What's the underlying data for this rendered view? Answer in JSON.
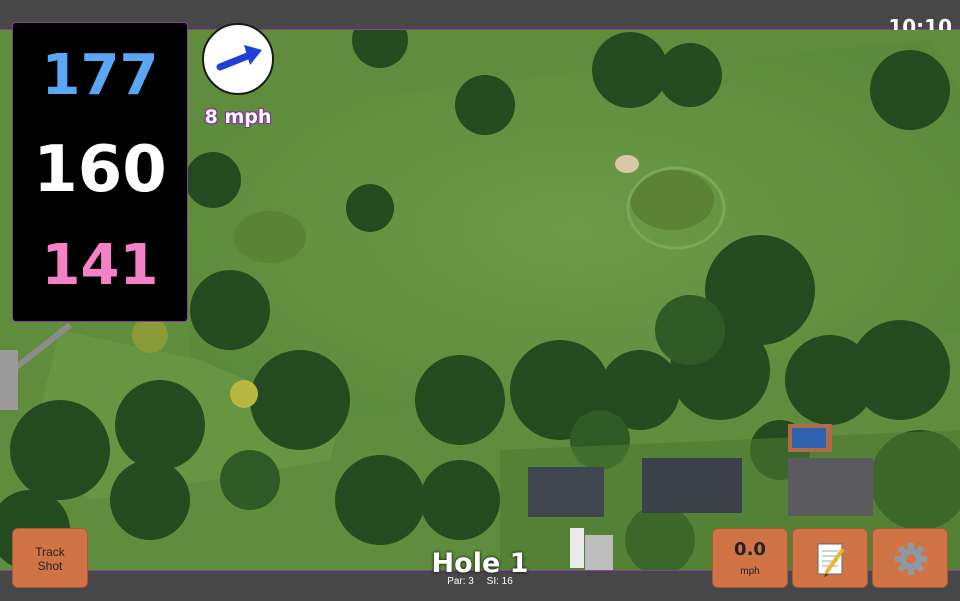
{
  "status": {
    "time": "10:10"
  },
  "distances": {
    "back": "177",
    "middle": "160",
    "front": "141"
  },
  "wind": {
    "speed": "8 mph",
    "direction_icon": "arrow-icon"
  },
  "hole": {
    "title": "Hole 1",
    "par_label": "Par: 3",
    "si_label": "SI: 16"
  },
  "buttons": {
    "track_shot": "Track Shot",
    "speed_value": "0.0",
    "speed_unit": "mph",
    "notes_icon": "notepad-icon",
    "settings_icon": "gear-icon"
  },
  "colors": {
    "back_distance": "#5aa8f5",
    "middle_distance": "#ffffff",
    "front_distance": "#f582c6",
    "button": "#d07345",
    "accent": "#8a3f9e"
  }
}
